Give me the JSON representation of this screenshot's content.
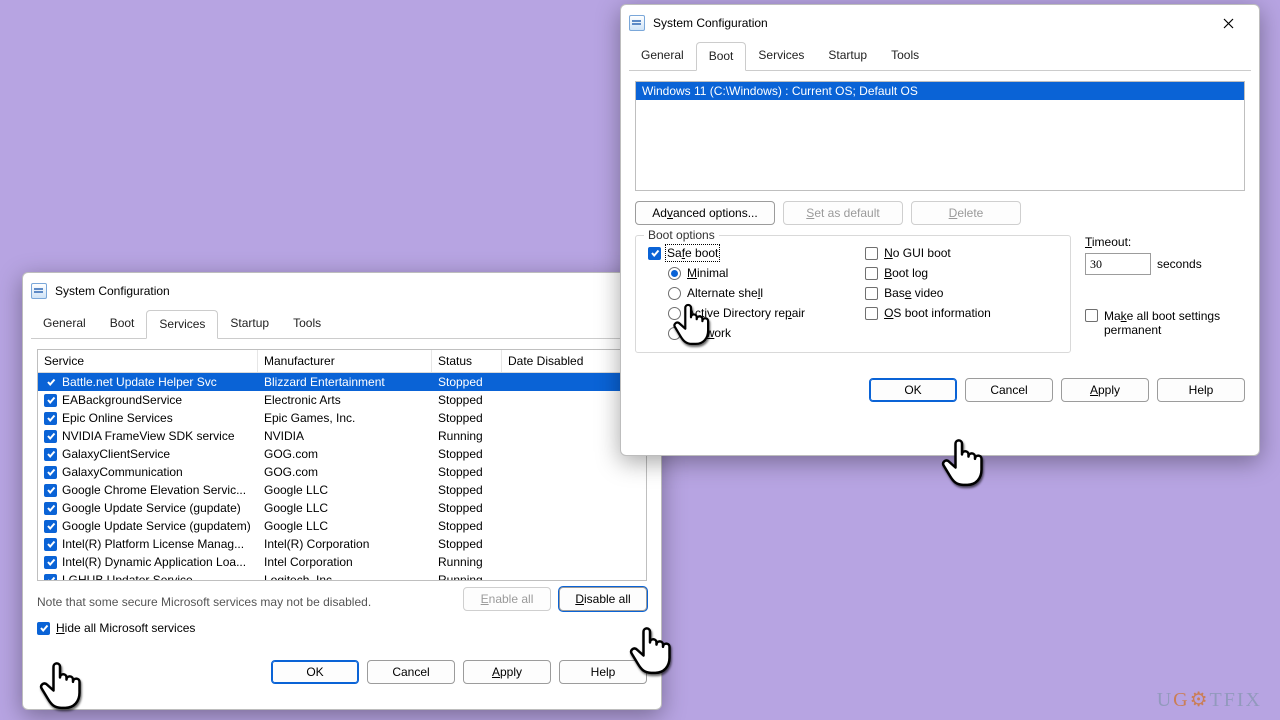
{
  "watermark": "UGETFIX",
  "services_win": {
    "title": "System Configuration",
    "tabs": [
      "General",
      "Boot",
      "Services",
      "Startup",
      "Tools"
    ],
    "active_tab": "Services",
    "columns": {
      "service": "Service",
      "manufacturer": "Manufacturer",
      "status": "Status",
      "date_disabled": "Date Disabled"
    },
    "rows": [
      {
        "svc": "Battle.net Update Helper Svc",
        "man": "Blizzard Entertainment",
        "st": "Stopped",
        "sel": true
      },
      {
        "svc": "EABackgroundService",
        "man": "Electronic Arts",
        "st": "Stopped"
      },
      {
        "svc": "Epic Online Services",
        "man": "Epic Games, Inc.",
        "st": "Stopped"
      },
      {
        "svc": "NVIDIA FrameView SDK service",
        "man": "NVIDIA",
        "st": "Running"
      },
      {
        "svc": "GalaxyClientService",
        "man": "GOG.com",
        "st": "Stopped"
      },
      {
        "svc": "GalaxyCommunication",
        "man": "GOG.com",
        "st": "Stopped"
      },
      {
        "svc": "Google Chrome Elevation Servic...",
        "man": "Google LLC",
        "st": "Stopped"
      },
      {
        "svc": "Google Update Service (gupdate)",
        "man": "Google LLC",
        "st": "Stopped"
      },
      {
        "svc": "Google Update Service (gupdatem)",
        "man": "Google LLC",
        "st": "Stopped"
      },
      {
        "svc": "Intel(R) Platform License Manag...",
        "man": "Intel(R) Corporation",
        "st": "Stopped"
      },
      {
        "svc": "Intel(R) Dynamic Application Loa...",
        "man": "Intel Corporation",
        "st": "Running"
      },
      {
        "svc": "LGHUB Updater Service",
        "man": "Logitech, Inc.",
        "st": "Running"
      }
    ],
    "note": "Note that some secure Microsoft services may not be disabled.",
    "enable_all": "Enable all",
    "disable_all": "Disable all",
    "hide_ms": "Hide all Microsoft services",
    "buttons": {
      "ok": "OK",
      "cancel": "Cancel",
      "apply": "Apply",
      "help": "Help"
    }
  },
  "boot_win": {
    "title": "System Configuration",
    "tabs": [
      "General",
      "Boot",
      "Services",
      "Startup",
      "Tools"
    ],
    "active_tab": "Boot",
    "os_entry": "Windows 11 (C:\\Windows) : Current OS; Default OS",
    "adv": "Advanced options...",
    "set_default": "Set as default",
    "delete": "Delete",
    "group": "Boot options",
    "safe_boot": "Safe boot",
    "minimal": "Minimal",
    "alt_shell": "Alternate shell",
    "ad_repair": "Active Directory repair",
    "network": "Network",
    "no_gui": "No GUI boot",
    "boot_log": "Boot log",
    "base_video": "Base video",
    "os_info": "OS boot information",
    "timeout_lbl": "Timeout:",
    "timeout_val": "30",
    "seconds": "seconds",
    "perm": "Make all boot settings permanent",
    "buttons": {
      "ok": "OK",
      "cancel": "Cancel",
      "apply": "Apply",
      "help": "Help"
    }
  }
}
